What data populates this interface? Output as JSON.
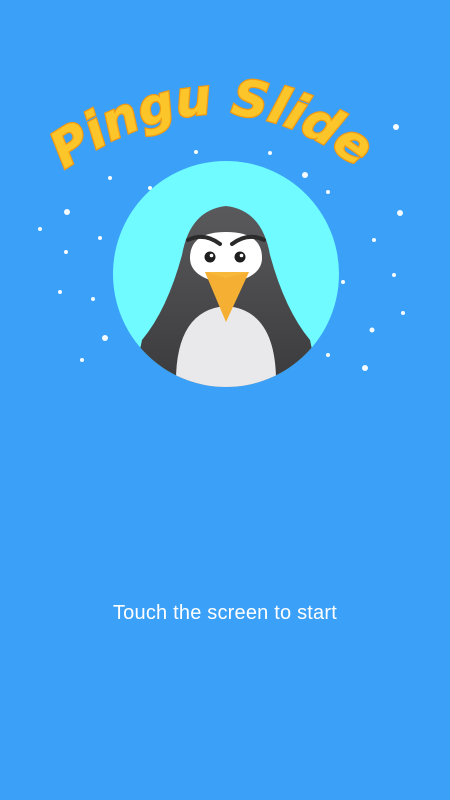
{
  "game": {
    "title": "Pingu Slide",
    "start_prompt": "Touch the screen to start"
  },
  "colors": {
    "background": "#3ba0f8",
    "title_fill": "#fcc52a",
    "title_outline": "#f29a12",
    "circle": "#6ffbff",
    "penguin_body": "#4a4a4a",
    "penguin_belly": "#e9e9ec",
    "beak": "#f8b93a",
    "snow": "#ffffff"
  },
  "icons": {
    "logo": "penguin-icon",
    "snow": "snowflake-dots"
  }
}
